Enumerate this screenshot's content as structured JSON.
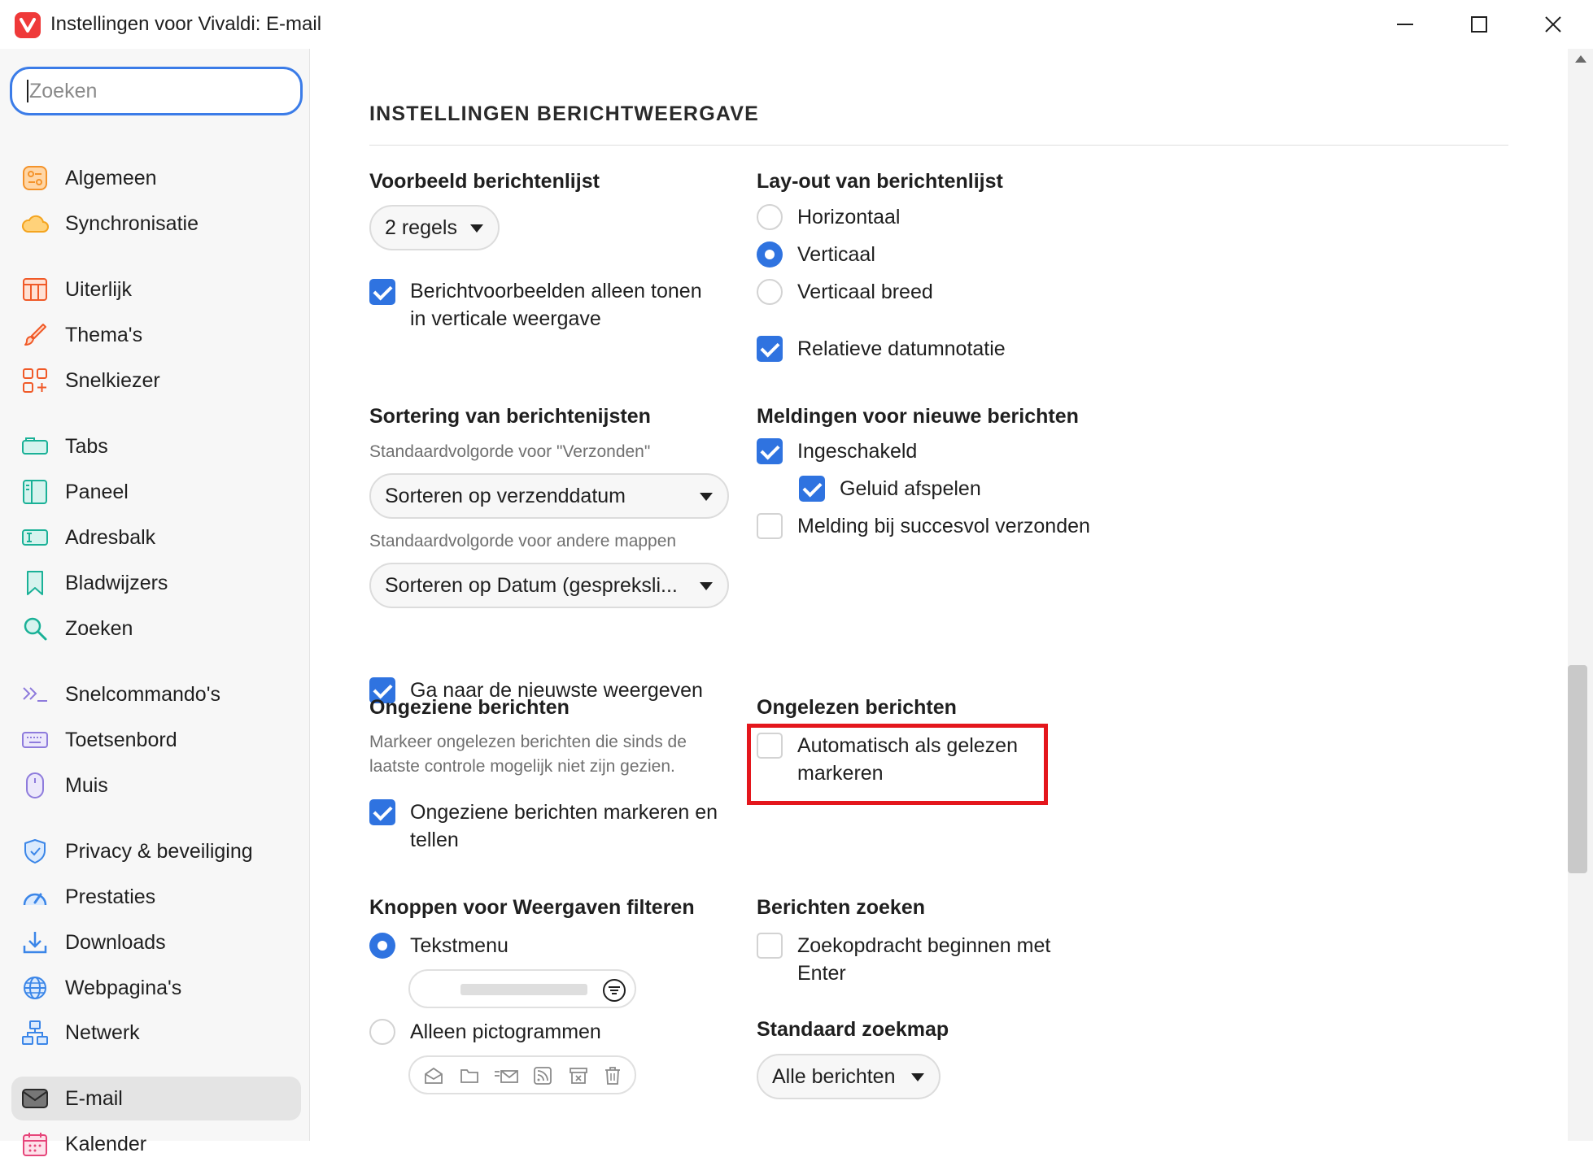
{
  "window": {
    "title": "Instellingen voor Vivaldi: E-mail",
    "brand_color": "#ef3939"
  },
  "sidebar": {
    "search_placeholder": "Zoeken",
    "items": [
      {
        "label": "Algemeen",
        "icon": "general-icon"
      },
      {
        "label": "Synchronisatie",
        "icon": "cloud-icon"
      },
      {
        "label": "Uiterlijk",
        "icon": "appearance-icon"
      },
      {
        "label": "Thema's",
        "icon": "brush-icon"
      },
      {
        "label": "Snelkiezer",
        "icon": "speed-dial-icon"
      },
      {
        "label": "Tabs",
        "icon": "tabs-icon"
      },
      {
        "label": "Paneel",
        "icon": "panel-icon"
      },
      {
        "label": "Adresbalk",
        "icon": "address-bar-icon"
      },
      {
        "label": "Bladwijzers",
        "icon": "bookmark-icon"
      },
      {
        "label": "Zoeken",
        "icon": "search-icon"
      },
      {
        "label": "Snelcommando's",
        "icon": "quick-commands-icon"
      },
      {
        "label": "Toetsenbord",
        "icon": "keyboard-icon"
      },
      {
        "label": "Muis",
        "icon": "mouse-icon"
      },
      {
        "label": "Privacy & beveiliging",
        "icon": "shield-icon"
      },
      {
        "label": "Prestaties",
        "icon": "gauge-icon"
      },
      {
        "label": "Downloads",
        "icon": "download-icon"
      },
      {
        "label": "Webpagina's",
        "icon": "globe-icon"
      },
      {
        "label": "Netwerk",
        "icon": "network-icon"
      },
      {
        "label": "E-mail",
        "icon": "mail-icon",
        "active": true
      },
      {
        "label": "Kalender",
        "icon": "calendar-icon"
      }
    ]
  },
  "main": {
    "section_title": "INSTELLINGEN BERICHTWEERGAVE",
    "preview": {
      "heading": "Voorbeeld berichtenlijst",
      "dropdown_value": "2 regels",
      "checkbox_label_line1": "Berichtvoorbeelden alleen tonen",
      "checkbox_label_line2": "in verticale weergave",
      "checked": true
    },
    "layout": {
      "heading": "Lay-out van berichtenlijst",
      "options": [
        "Horizontaal",
        "Verticaal",
        "Verticaal breed"
      ],
      "selected": "Verticaal",
      "relative_date_label": "Relatieve datumnotatie",
      "relative_date_checked": true
    },
    "sorting": {
      "heading": "Sortering van berichtenijsten",
      "sent_desc": "Standaardvolgorde voor \"Verzonden\"",
      "sent_value": "Sorteren op verzenddatum",
      "other_desc": "Standaardvolgorde voor andere mappen",
      "other_value": "Sorteren op Datum (gespreksli...",
      "newest_label": "Ga naar de nieuwste weergeven",
      "newest_checked": true
    },
    "notifications": {
      "heading": "Meldingen voor nieuwe berichten",
      "enabled_label": "Ingeschakeld",
      "sound_label": "Geluid afspelen",
      "sent_success_label": "Melding bij succesvol verzonden"
    },
    "unseen": {
      "heading": "Ongeziene berichten",
      "desc_line1": "Markeer ongelezen berichten die sinds de",
      "desc_line2": "laatste controle mogelijk niet zijn gezien.",
      "label_line1": "Ongeziene berichten markeren en",
      "label_line2": "tellen"
    },
    "unread": {
      "heading": "Ongelezen berichten",
      "label_line1": "Automatisch als gelezen",
      "label_line2": "markeren",
      "highlight_color": "#e4161c"
    },
    "filter_buttons": {
      "heading": "Knoppen voor Weergaven filteren",
      "text_menu_label": "Tekstmenu",
      "icons_only_label": "Alleen pictogrammen",
      "selected": "Tekstmenu"
    },
    "search_messages": {
      "heading": "Berichten zoeken",
      "label_line1": "Zoekopdracht beginnen met",
      "label_line2": "Enter"
    },
    "default_search_folder": {
      "heading": "Standaard zoekmap",
      "value": "Alle berichten"
    }
  }
}
